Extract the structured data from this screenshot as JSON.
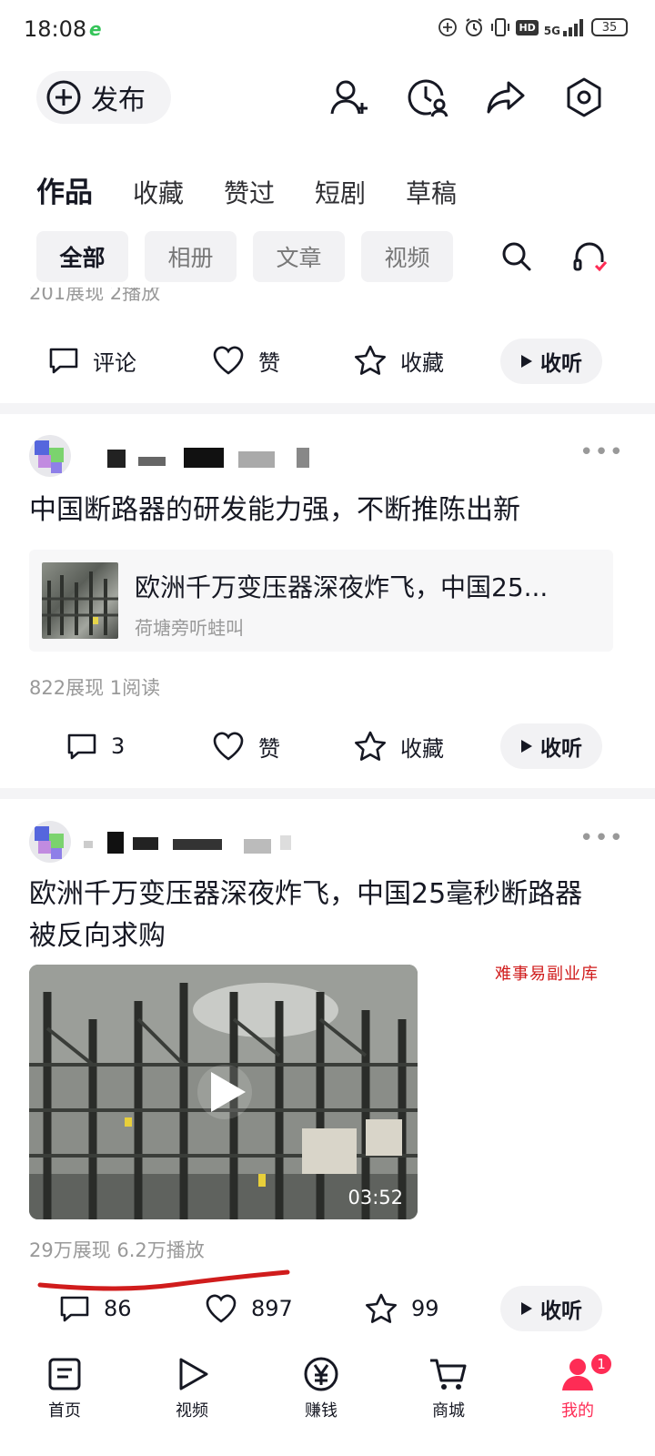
{
  "status_bar": {
    "time": "18:08",
    "network": "5G",
    "hd": "HD",
    "battery": "35"
  },
  "header": {
    "publish_label": "发布",
    "icons": [
      "add-friend-icon",
      "history-icon",
      "share-icon",
      "settings-icon"
    ]
  },
  "tabs": [
    "作品",
    "收藏",
    "赞过",
    "短剧",
    "草稿"
  ],
  "filter_chips": [
    "全部",
    "相册",
    "文章",
    "视频"
  ],
  "prev_post": {
    "stats": "201展现   2播放",
    "comment_label": "评论",
    "like_label": "赞",
    "fav_label": "收藏",
    "listen_label": "收听"
  },
  "post1": {
    "title": "中国断路器的研发能力强，不断推陈出新",
    "card_title": "欧洲千万变压器深夜炸飞，中国25...",
    "card_author": "荷塘旁听蛙叫",
    "stats": "822展现   1阅读",
    "comments": "3",
    "like_label": "赞",
    "fav_label": "收藏",
    "listen_label": "收听"
  },
  "post2": {
    "title_line1": "欧洲千万变压器深夜炸飞，中国25毫秒断路器",
    "title_line2": "被反向求购",
    "duration": "03:52",
    "watermark": "难事易副业库",
    "stats": "29万展现   6.2万播放",
    "comments": "86",
    "likes": "897",
    "favorites": "99",
    "listen_label": "收听"
  },
  "bottom_nav": {
    "items": [
      "首页",
      "视频",
      "赚钱",
      "商城",
      "我的"
    ],
    "active": "我的",
    "badge": "1"
  },
  "colors": {
    "accent": "#fe2c55",
    "annotation": "#d01c1c"
  }
}
